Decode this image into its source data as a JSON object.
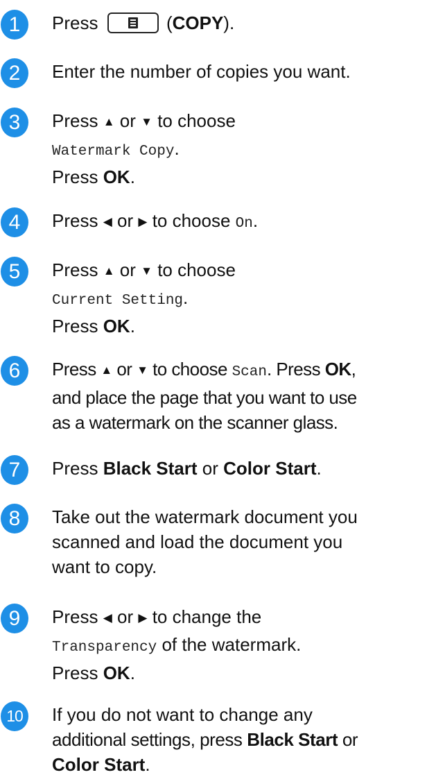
{
  "accent_color": "#1e8fe6",
  "steps": [
    {
      "num": "1",
      "press": "Press",
      "copy_open": "(",
      "copy_key": "COPY",
      "copy_close": ").",
      "key_icon": "copy-key-icon"
    },
    {
      "num": "2",
      "text": "Enter the number of copies you want."
    },
    {
      "num": "3",
      "press": "Press",
      "up": "▲",
      "or": "or",
      "down": "▼",
      "to_choose": "to choose",
      "option": "Watermark Copy",
      "period": ".",
      "press2": "Press",
      "ok": "OK"
    },
    {
      "num": "4",
      "press": "Press",
      "left": "◀",
      "or": "or",
      "right": "▶",
      "to_choose": "to choose",
      "option": "On",
      "period": "."
    },
    {
      "num": "5",
      "press": "Press",
      "up": "▲",
      "or": "or",
      "down": "▼",
      "to_choose": "to choose",
      "option": "Current Setting",
      "period": ".",
      "press2": "Press",
      "ok": "OK"
    },
    {
      "num": "6",
      "press": "Press",
      "up": "▲",
      "or": "or",
      "down": "▼",
      "to_choose": "to choose",
      "option": "Scan",
      "press_ok_lead": ". Press",
      "ok": "OK",
      "comma": ",",
      "line2": "and place the page that you want to use",
      "line3": "as a watermark on the scanner glass."
    },
    {
      "num": "7",
      "press": "Press",
      "black_start": "Black Start",
      "or": "or",
      "color_start": "Color Start",
      "period": "."
    },
    {
      "num": "8",
      "line1": "Take out the watermark document you",
      "line2": "scanned and load the document you",
      "line3": "want to copy."
    },
    {
      "num": "9",
      "press": "Press",
      "left": "◀",
      "or": "or",
      "right": "▶",
      "to_change": "to change the",
      "option": "Transparency",
      "of_watermark": "of the watermark.",
      "press2": "Press",
      "ok": "OK"
    },
    {
      "num": "10",
      "line1": "If you do not want to change any",
      "line2_lead": "additional settings, press",
      "black_start": "Black Start",
      "or": "or",
      "color_start": "Color Start",
      "period": "."
    }
  ]
}
